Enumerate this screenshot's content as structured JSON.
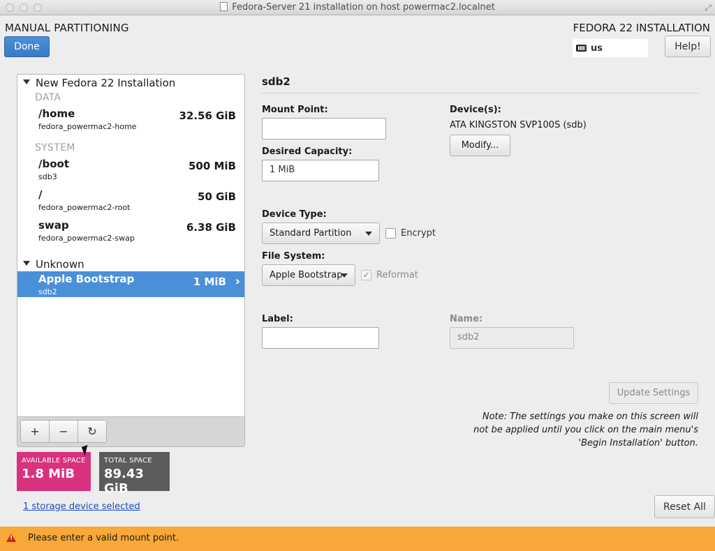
{
  "window": {
    "title": "Fedora-Server 21 installation on host powermac2.localnet"
  },
  "header": {
    "title": "MANUAL PARTITIONING",
    "product": "FEDORA 22 INSTALLATION",
    "done_label": "Done",
    "keyboard_layout": "us",
    "help_label": "Help!"
  },
  "partitions": {
    "new_install_header": "New Fedora 22 Installation",
    "data_section": "DATA",
    "system_section": "SYSTEM",
    "unknown_header": "Unknown",
    "items": [
      {
        "mount": "/home",
        "device": "fedora_powermac2-home",
        "size": "32.56 GiB"
      },
      {
        "mount": "/boot",
        "device": "sdb3",
        "size": "500 MiB"
      },
      {
        "mount": "/",
        "device": "fedora_powermac2-root",
        "size": "50 GiB"
      },
      {
        "mount": "swap",
        "device": "fedora_powermac2-swap",
        "size": "6.38 GiB"
      }
    ],
    "selected": {
      "mount": "Apple Bootstrap",
      "device": "sdb2",
      "size": "1 MiB"
    },
    "toolbar": {
      "add": "+",
      "remove": "−",
      "refresh": "↻"
    }
  },
  "space": {
    "available_label": "AVAILABLE SPACE",
    "available_value": "1.8 MiB",
    "total_label": "TOTAL SPACE",
    "total_value": "89.43 GiB"
  },
  "storage_link": "1 storage device selected",
  "reset_label": "Reset All",
  "warning": {
    "icon": "warning-icon",
    "text": "Please enter a valid mount point."
  },
  "details": {
    "title": "sdb2",
    "mount_point_label": "Mount Point:",
    "mount_point_value": "",
    "desired_capacity_label": "Desired Capacity:",
    "desired_capacity_value": "1 MiB",
    "devices_label": "Device(s):",
    "devices_value": "ATA KINGSTON SVP100S (sdb)",
    "modify_label": "Modify...",
    "device_type_label": "Device Type:",
    "device_type_value": "Standard Partition",
    "encrypt_label": "Encrypt",
    "encrypt_checked": false,
    "file_system_label": "File System:",
    "file_system_value": "Apple Bootstrap",
    "reformat_label": "Reformat",
    "reformat_checked": true,
    "label_label": "Label:",
    "label_value": "",
    "name_label": "Name:",
    "name_value": "sdb2",
    "update_label": "Update Settings",
    "note": "Note:  The settings you make on this screen will not be applied until you click on the main menu's 'Begin Installation' button."
  },
  "colors": {
    "accent": "#4a90d9",
    "available": "#d9317e",
    "total": "#5c5c5c",
    "warning_bar": "#f7a838"
  }
}
